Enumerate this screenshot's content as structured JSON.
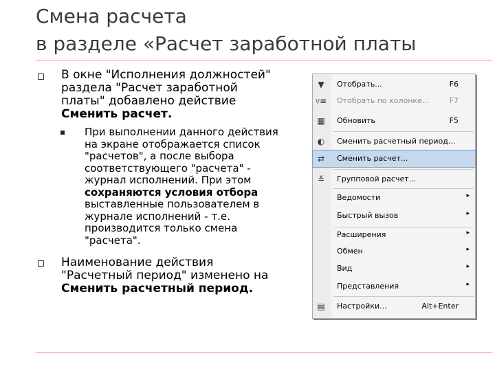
{
  "slide": {
    "title_line1": "Смена расчета",
    "title_line2": "в разделе «Расчет заработной платы"
  },
  "bullets": {
    "b1": {
      "line1": "В окне \"Исполнения должностей\"",
      "line2": "раздела \"Расчет заработной",
      "line3": "платы\" добавлено действие",
      "line4_bold": "Сменить расчет."
    },
    "sub": {
      "line1": "При выполнении данного действия",
      "line2": "на экране отображается список",
      "line3": "\"расчетов\", а после выбора",
      "line4": "соответствующего \"расчета\" -",
      "line5": "журнал исполнений. При этом",
      "line6_bold": "сохраняются условия отбора",
      "line7": "выставленные пользователем в",
      "line8": "журнале исполнений - т.е.",
      "line9": "производится только смена",
      "line10": "\"расчета\"."
    },
    "b2": {
      "line1": "Наименование действия",
      "line2": "\"Расчетный период\" изменено на",
      "line3_bold": "Сменить расчетный период."
    }
  },
  "menu": {
    "items": [
      {
        "label": "Отобрать...",
        "shortcut": "F6",
        "icon": "filter-icon"
      },
      {
        "label": "Отобрать по колонке...",
        "shortcut": "F7",
        "icon": "column-filter-icon"
      },
      {
        "label": "Обновить",
        "shortcut": "F5",
        "icon": "refresh-icon"
      },
      {
        "label": "Сменить расчетный период...",
        "icon": "period-icon"
      },
      {
        "label": "Сменить расчет...",
        "icon": "change-calc-icon"
      },
      {
        "label": "Групповой расчет...",
        "icon": "group-calc-icon"
      },
      {
        "label": "Ведомости",
        "submenu": "▸"
      },
      {
        "label": "Быстрый вызов",
        "submenu": "▸"
      },
      {
        "label": "Расширения",
        "submenu": "▸"
      },
      {
        "label": "Обмен",
        "submenu": "▸"
      },
      {
        "label": "Вид",
        "submenu": "▸"
      },
      {
        "label": "Представления",
        "submenu": "▸"
      },
      {
        "label": "Настройки...",
        "shortcut": "Alt+Enter",
        "icon": "settings-icon"
      }
    ]
  }
}
